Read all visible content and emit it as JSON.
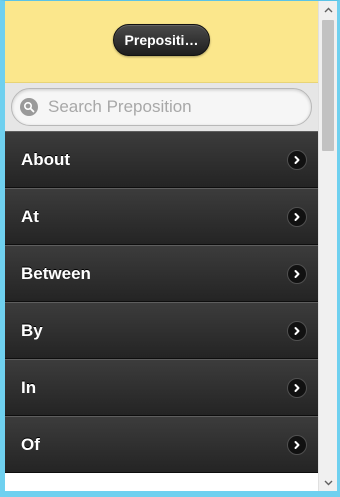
{
  "header": {
    "title": "Prepositi…"
  },
  "search": {
    "placeholder": "Search Preposition",
    "value": ""
  },
  "list": {
    "items": [
      {
        "label": "About"
      },
      {
        "label": "At"
      },
      {
        "label": "Between"
      },
      {
        "label": "By"
      },
      {
        "label": "In"
      },
      {
        "label": "Of"
      }
    ]
  },
  "colors": {
    "header_bg": "#fbe78c",
    "list_bg": "#2f2f2f",
    "window_border": "#6fd0ef"
  },
  "icons": [
    "search-icon",
    "chevron-right-icon",
    "scroll-up-arrow-icon",
    "scroll-down-arrow-icon"
  ]
}
